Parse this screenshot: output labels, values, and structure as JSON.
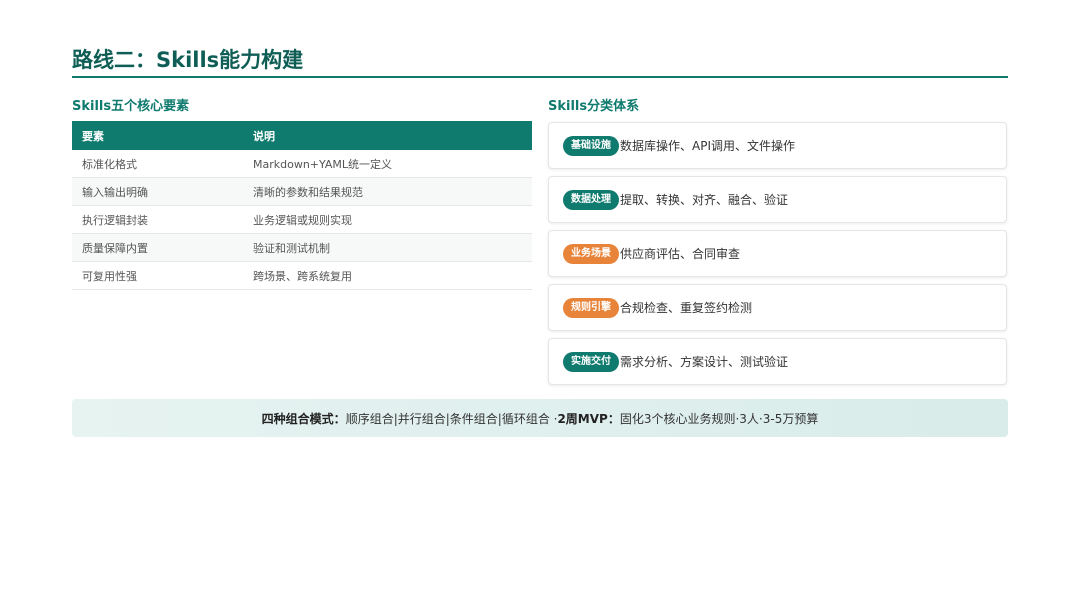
{
  "title": "路线二：Skills能力构建",
  "left": {
    "heading": "Skills五个核心要素",
    "table": {
      "headers": [
        "要素",
        "说明"
      ],
      "rows": [
        [
          "标准化格式",
          "Markdown+YAML统一定义"
        ],
        [
          "输入输出明确",
          "清晰的参数和结果规范"
        ],
        [
          "执行逻辑封装",
          "业务逻辑或规则实现"
        ],
        [
          "质量保障内置",
          "验证和测试机制"
        ],
        [
          "可复用性强",
          "跨场景、跨系统复用"
        ]
      ]
    }
  },
  "right": {
    "heading": "Skills分类体系",
    "cards": [
      {
        "tag": "基础设施",
        "text": "数据库操作、API调用、文件操作",
        "tag_color": "#0f7a6e"
      },
      {
        "tag": "数据处理",
        "text": "提取、转换、对齐、融合、验证",
        "tag_color": "#0f7a6e"
      },
      {
        "tag": "业务场景",
        "text": "供应商评估、合同审查",
        "tag_color": "#e8843a"
      },
      {
        "tag": "规则引擎",
        "text": "合规检查、重复签约检测",
        "tag_color": "#e8843a"
      },
      {
        "tag": "实施交付",
        "text": "需求分析、方案设计、测试验证",
        "tag_color": "#0f7a6e"
      }
    ]
  },
  "banner": {
    "label1": "四种组合模式：",
    "text1": "顺序组合|并行组合|条件组合|循环组合 · ",
    "label2": "2周MVP：",
    "text2": "固化3个核心业务规则·3人·3-5万预算"
  },
  "colors": {
    "primary": "#0f7a6e",
    "accent": "#e8843a"
  }
}
